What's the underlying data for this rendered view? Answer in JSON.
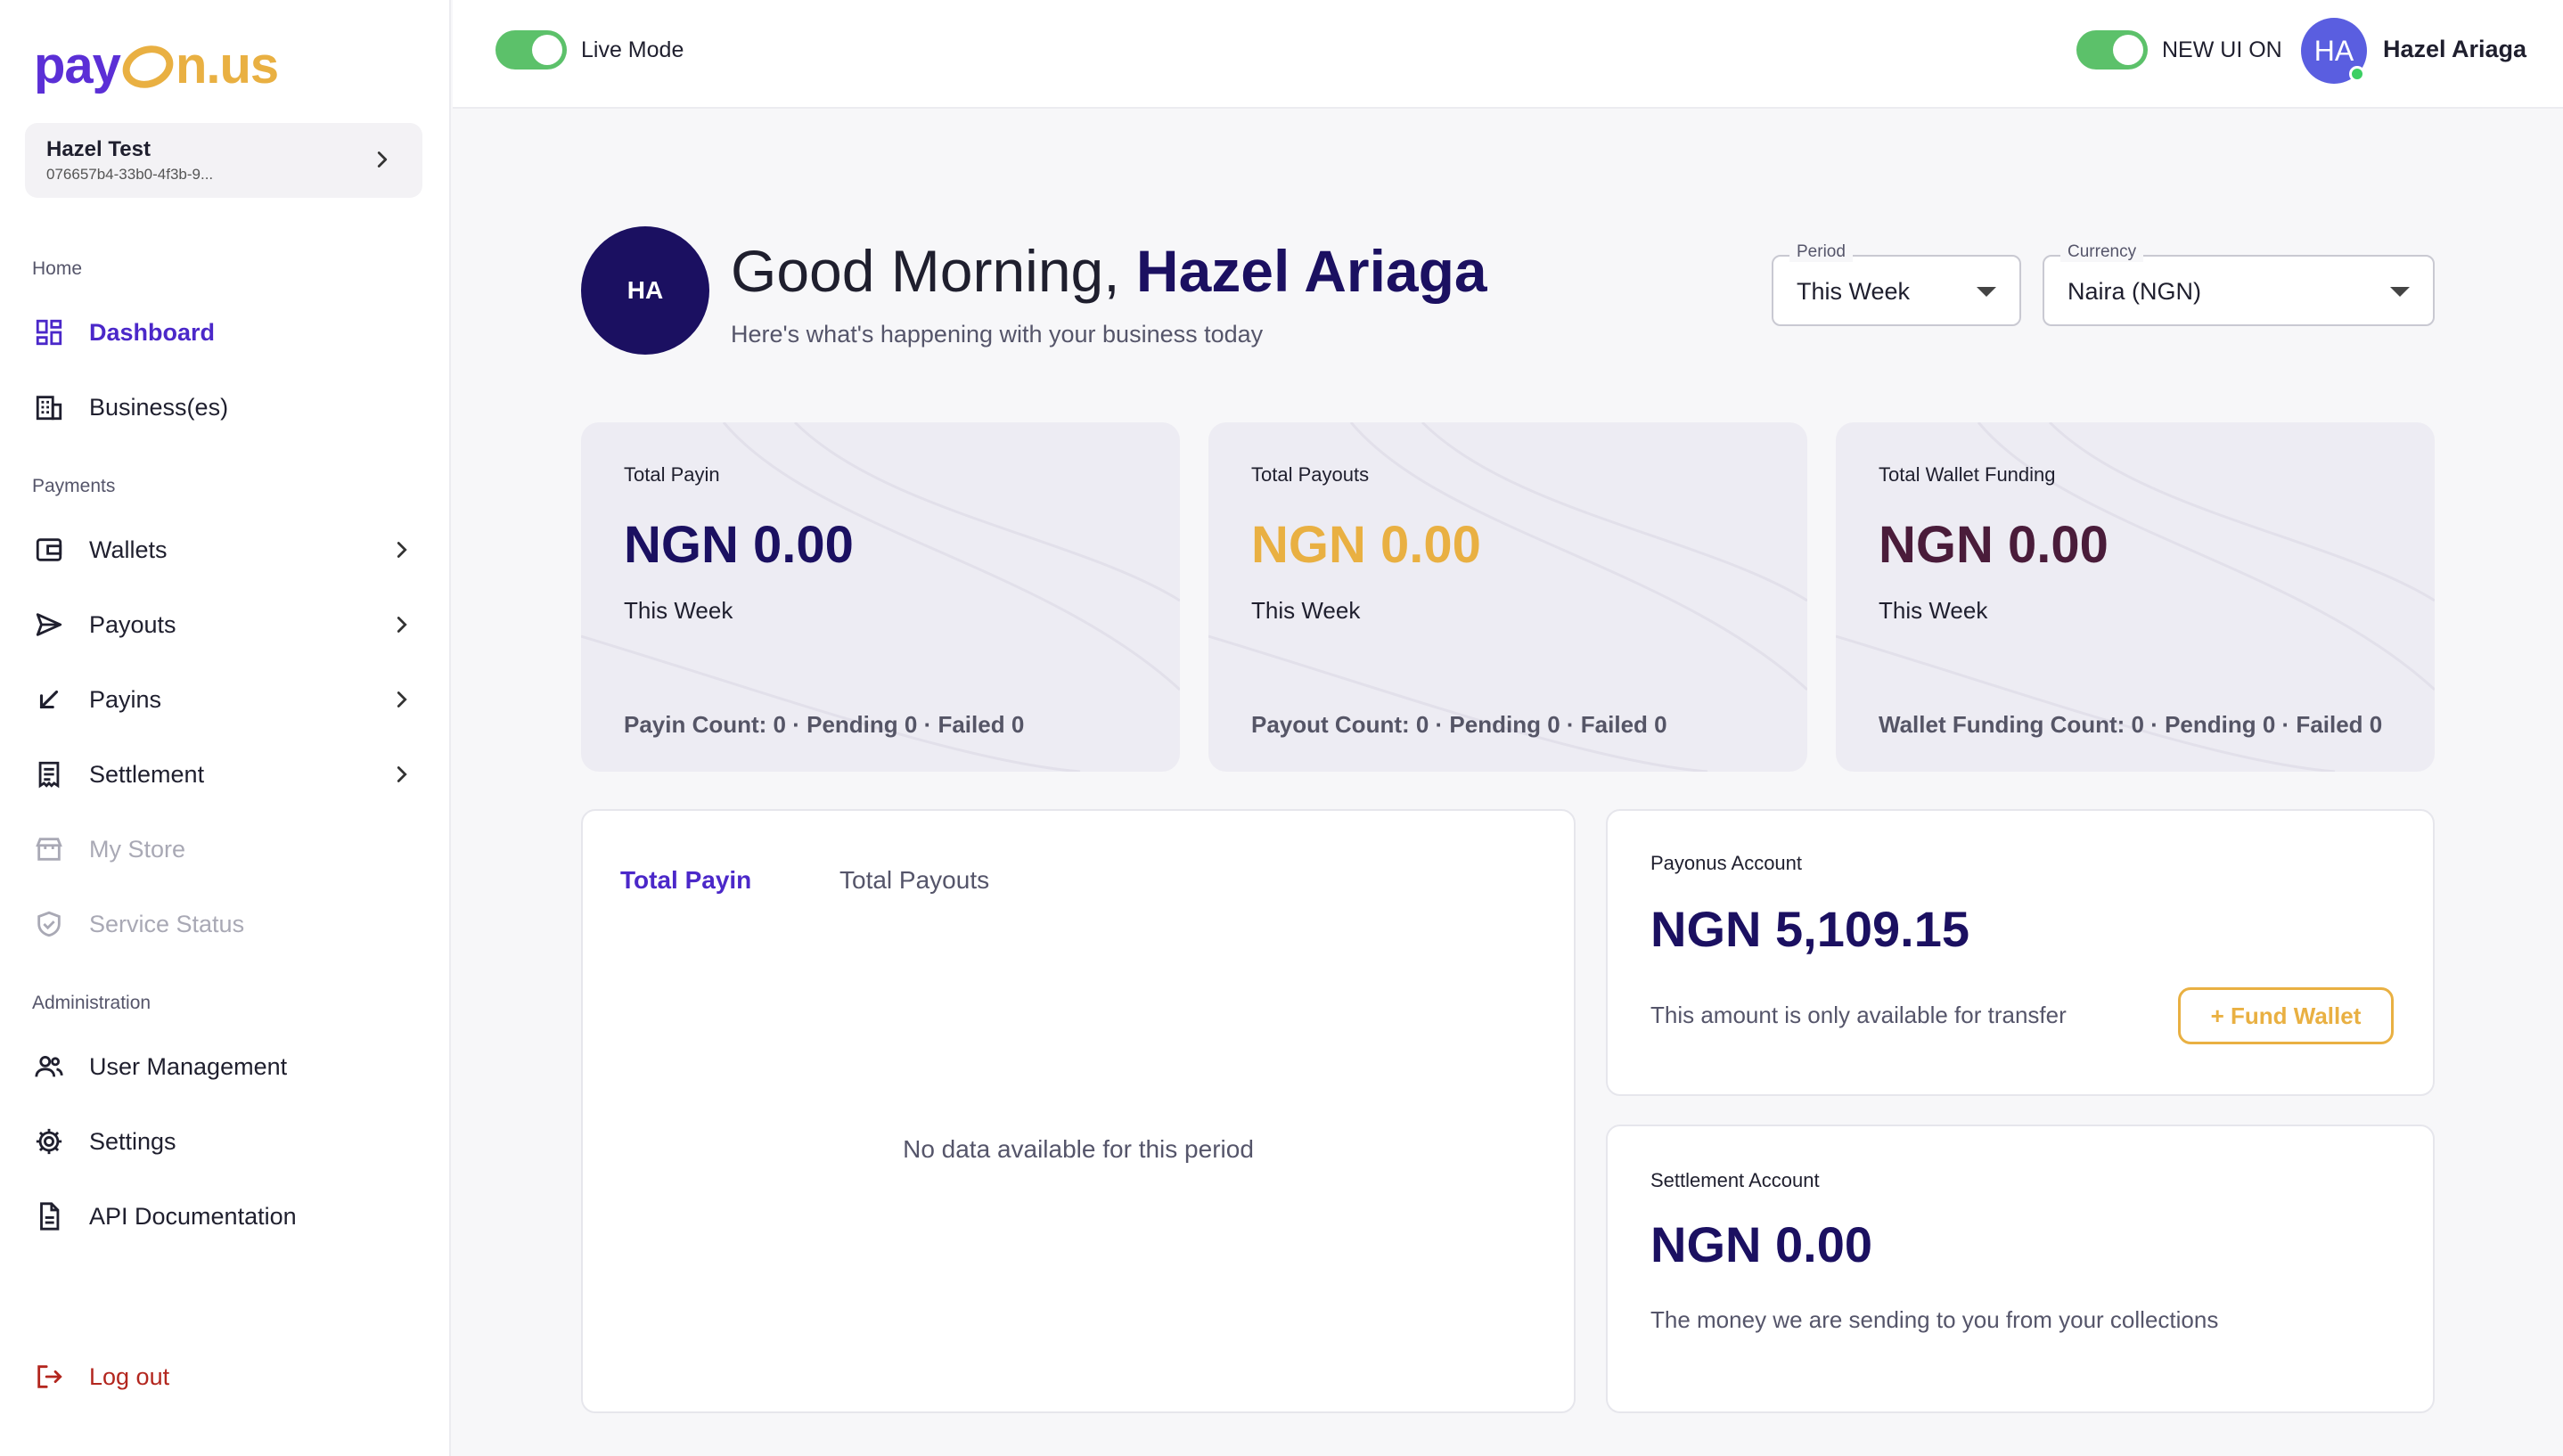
{
  "brand": {
    "logo_left": "pay",
    "logo_right": "n.us",
    "accent": "#4b28c9",
    "gold": "#e9b042",
    "navy": "#1b1061"
  },
  "business": {
    "name": "Hazel Test",
    "id": "076657b4-33b0-4f3b-9..."
  },
  "sidebar": {
    "sections": {
      "home": "Home",
      "payments": "Payments",
      "administration": "Administration"
    },
    "items": {
      "dashboard": "Dashboard",
      "businesses": "Business(es)",
      "wallets": "Wallets",
      "payouts": "Payouts",
      "payins": "Payins",
      "settlement": "Settlement",
      "my_store": "My Store",
      "service_status": "Service Status",
      "user_management": "User Management",
      "settings": "Settings",
      "api_docs": "API Documentation",
      "logout": "Log out"
    }
  },
  "topbar": {
    "live_mode": "Live Mode",
    "new_ui": "NEW UI ON",
    "avatar_initials": "HA",
    "user_name": "Hazel Ariaga"
  },
  "greeting": {
    "avatar_initials": "HA",
    "prefix": "Good Morning, ",
    "name": "Hazel Ariaga",
    "subtitle": "Here's what's happening with your business today"
  },
  "filters": {
    "period_label": "Period",
    "period_value": "This Week",
    "currency_label": "Currency",
    "currency_value": "Naira (NGN)"
  },
  "stats": [
    {
      "title": "Total Payin",
      "amount": "NGN 0.00",
      "color": "#1b1061",
      "period": "This Week",
      "footer": "Payin Count: 0 · Pending 0 · Failed 0"
    },
    {
      "title": "Total Payouts",
      "amount": "NGN 0.00",
      "color": "#e9b042",
      "period": "This Week",
      "footer": "Payout Count: 0 · Pending 0 · Failed 0"
    },
    {
      "title": "Total Wallet Funding",
      "amount": "NGN 0.00",
      "color": "#4a1c3a",
      "period": "This Week",
      "footer": "Wallet Funding Count: 0 · Pending 0 · Failed 0"
    }
  ],
  "chart": {
    "tab_active": "Total Payin",
    "tab_other": "Total Payouts",
    "empty_message": "No data available for this period"
  },
  "payonus_account": {
    "title": "Payonus Account",
    "amount": "NGN 5,109.15",
    "note": "This amount is only available for transfer",
    "fund_button": "+ Fund Wallet"
  },
  "settlement_account": {
    "title": "Settlement Account",
    "amount": "NGN 0.00",
    "note": "The money we are sending to you from your collections"
  }
}
